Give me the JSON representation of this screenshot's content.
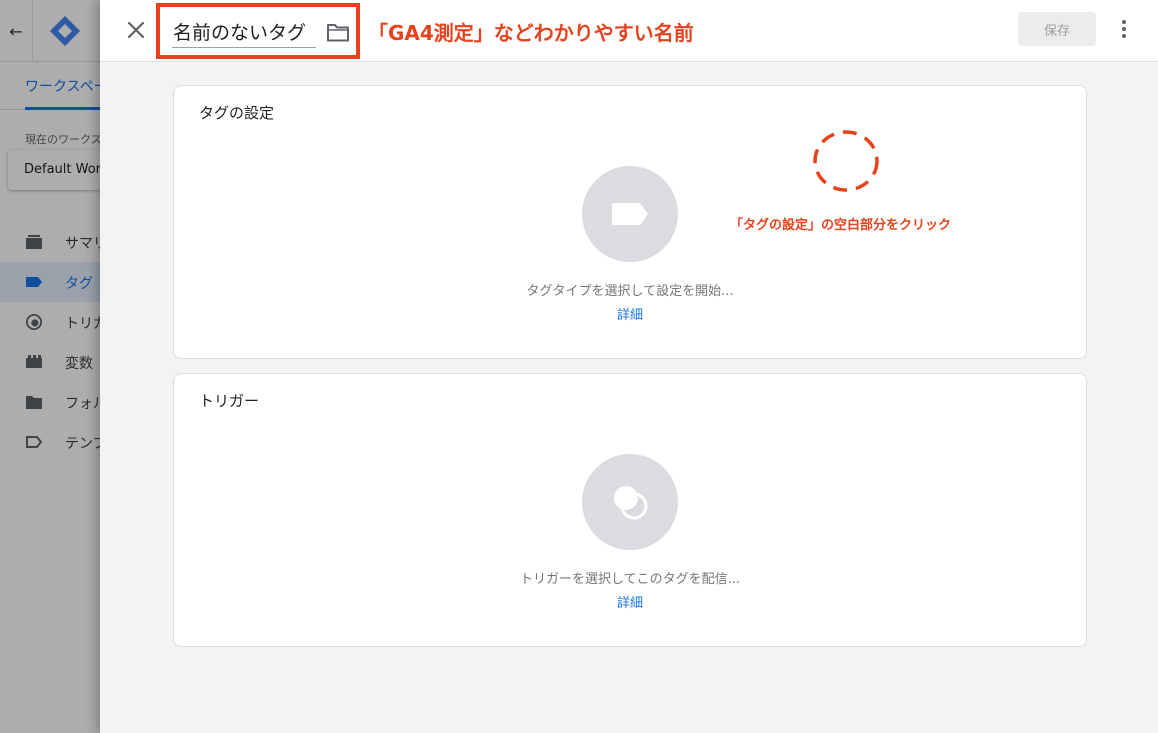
{
  "background": {
    "workspace_tab": "ワークスペース",
    "current_workspace_label": "現在のワークスペース",
    "workspace_name": "Default Workspace",
    "nav_items": [
      {
        "label": "サマリー"
      },
      {
        "label": "タグ",
        "active": true
      },
      {
        "label": "トリガー"
      },
      {
        "label": "変数"
      },
      {
        "label": "フォルダ"
      },
      {
        "label": "テンプレート"
      }
    ]
  },
  "header": {
    "tag_name": "名前のないタグ",
    "annotation": "「GA4測定」などわかりやすい名前",
    "save_label": "保存"
  },
  "tag_config": {
    "title": "タグの設定",
    "prompt": "タグタイプを選択して設定を開始...",
    "link": "詳細",
    "annotation": "「タグの設定」の空白部分をクリック"
  },
  "trigger": {
    "title": "トリガー",
    "prompt": "トリガーを選択してこのタグを配信...",
    "link": "詳細"
  },
  "colors": {
    "annotation": "#e5431d",
    "link": "#1a73e8",
    "circle": "#dadce0",
    "save_disabled": "#ececec"
  }
}
